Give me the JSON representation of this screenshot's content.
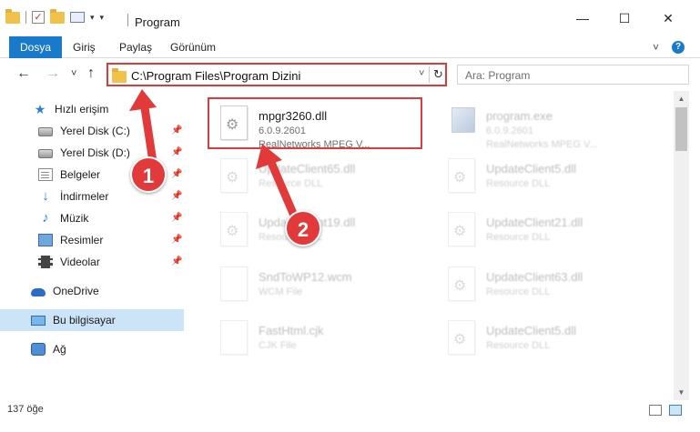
{
  "window": {
    "title": "Program",
    "minimize": "—",
    "maximize": "☐",
    "close": "✕"
  },
  "ribbon": {
    "tabs": [
      {
        "label": "Dosya",
        "active": true
      },
      {
        "label": "Giriş"
      },
      {
        "label": "Paylaş"
      },
      {
        "label": "Görünüm"
      }
    ],
    "expand_glyph": "˅",
    "help_glyph": "?"
  },
  "nav": {
    "back": "←",
    "forward": "→",
    "recent": "˅",
    "up": "↑",
    "address": "C:\\Program Files\\Program Dizini",
    "address_dropdown": "˅",
    "refresh": "↻",
    "search_placeholder": "Ara: Program"
  },
  "sidebar": {
    "items": [
      {
        "label": "Hızlı erişim",
        "icon": "star-icon"
      },
      {
        "label": "Yerel Disk (C:)",
        "icon": "drive-icon",
        "pinned": true
      },
      {
        "label": "Yerel Disk (D:)",
        "icon": "drive-icon",
        "pinned": true
      },
      {
        "label": "Belgeler",
        "icon": "documents-icon",
        "pinned": true
      },
      {
        "label": "İndirmeler",
        "icon": "download-icon",
        "pinned": true
      },
      {
        "label": "Müzik",
        "icon": "music-icon",
        "pinned": true
      },
      {
        "label": "Resimler",
        "icon": "pictures-icon",
        "pinned": true
      },
      {
        "label": "Videolar",
        "icon": "videos-icon",
        "pinned": true
      },
      {
        "label": "OneDrive",
        "icon": "cloud-icon"
      },
      {
        "label": "Bu bilgisayar",
        "icon": "computer-icon",
        "selected": true
      },
      {
        "label": "Ağ",
        "icon": "network-icon"
      }
    ],
    "pin_glyph": "📌"
  },
  "files": [
    {
      "name": "mpgr3260.dll",
      "version": "6.0.9.2601",
      "description": "RealNetworks MPEG V...",
      "highlighted": true
    },
    {
      "name": "program.exe",
      "version": "6.0.9.2601",
      "description": "RealNetworks MPEG V..."
    },
    {
      "name": "UpdateClient65.dll",
      "version": "",
      "description": "Resource DLL"
    },
    {
      "name": "UpdateClient5.dll",
      "version": "",
      "description": "Resource DLL"
    },
    {
      "name": "UpdateClient19.dll",
      "version": "",
      "description": "Resource DLL"
    },
    {
      "name": "UpdateClient21.dll",
      "version": "",
      "description": "Resource DLL"
    },
    {
      "name": "SndToWP12.wcm",
      "version": "",
      "description": "WCM File"
    },
    {
      "name": "UpdateClient63.dll",
      "version": "",
      "description": "Resource DLL"
    },
    {
      "name": "FastHtml.cjk",
      "version": "",
      "description": "CJK File"
    },
    {
      "name": "UpdateClient5.dll",
      "version": "",
      "description": "Resource DLL"
    }
  ],
  "status": {
    "item_count": "137 öğe"
  },
  "annotations": {
    "step1": "1",
    "step2": "2",
    "color": "#e23a3a"
  },
  "colors": {
    "accent": "#1979ca",
    "highlight_border": "#dd3b3b",
    "selection": "#cce4f7"
  }
}
